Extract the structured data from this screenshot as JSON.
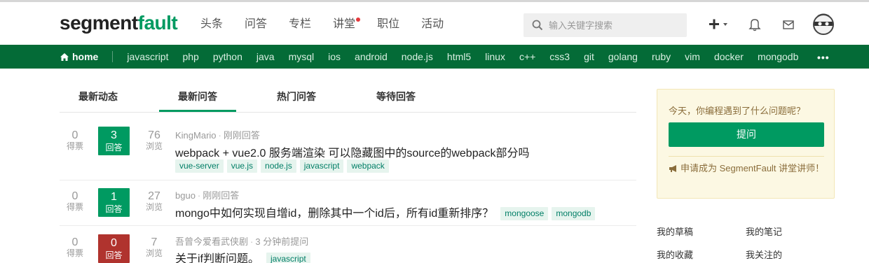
{
  "header": {
    "logo_part1": "segment",
    "logo_part2": "fault",
    "nav": [
      {
        "label": "头条"
      },
      {
        "label": "问答"
      },
      {
        "label": "专栏"
      },
      {
        "label": "讲堂",
        "has_dot": true
      },
      {
        "label": "职位"
      },
      {
        "label": "活动"
      }
    ],
    "search_placeholder": "输入关键字搜索",
    "icons": [
      "search-icon",
      "plus-icon",
      "bell-icon",
      "mail-icon",
      "avatar"
    ]
  },
  "tagbar": {
    "home": "home",
    "tags": [
      "javascript",
      "php",
      "python",
      "java",
      "mysql",
      "ios",
      "android",
      "node.js",
      "html5",
      "linux",
      "c++",
      "css3",
      "git",
      "golang",
      "ruby",
      "vim",
      "docker",
      "mongodb"
    ],
    "more": "•••"
  },
  "tabs": [
    "最新动态",
    "最新问答",
    "热门问答",
    "等待回答"
  ],
  "questions": [
    {
      "votes": "0",
      "votes_label": "得票",
      "answers": "3",
      "answers_label": "回答",
      "views": "76",
      "views_label": "浏览",
      "author": "KingMario",
      "time": "刚刚回答",
      "title": "webpack + vue2.0 服务端渲染 可以隐藏图中的source的webpack部分吗",
      "tags": [
        "vue-server",
        "vue.js",
        "node.js",
        "javascript",
        "webpack"
      ]
    },
    {
      "votes": "0",
      "votes_label": "得票",
      "answers": "1",
      "answers_label": "回答",
      "views": "27",
      "views_label": "浏览",
      "author": "bguo",
      "time": "刚刚回答",
      "title": "mongo中如何实现自增id，删除其中一个id后，所有id重新排序？",
      "tags": [
        "mongoose",
        "mongodb"
      ]
    },
    {
      "votes": "0",
      "votes_label": "得票",
      "answers": "0",
      "answers_label": "回答",
      "views": "7",
      "views_label": "浏览",
      "author": "吾曾今爱看武侠剧",
      "time": "3 分钟前提问",
      "title": "关于if判断问题。",
      "tags": [
        "javascript"
      ]
    }
  ],
  "sidebar": {
    "question": "今天，你编程遇到了什么问题呢？",
    "ask_button": "提问",
    "apply": "申请成为 SegmentFault 讲堂讲师！",
    "links": [
      "我的草稿",
      "我的笔记",
      "我的收藏",
      "我关注的"
    ]
  },
  "colors": {
    "brand_green": "#009a61",
    "tagbar_green": "#046b37",
    "answered_zero": "#b0332e"
  }
}
